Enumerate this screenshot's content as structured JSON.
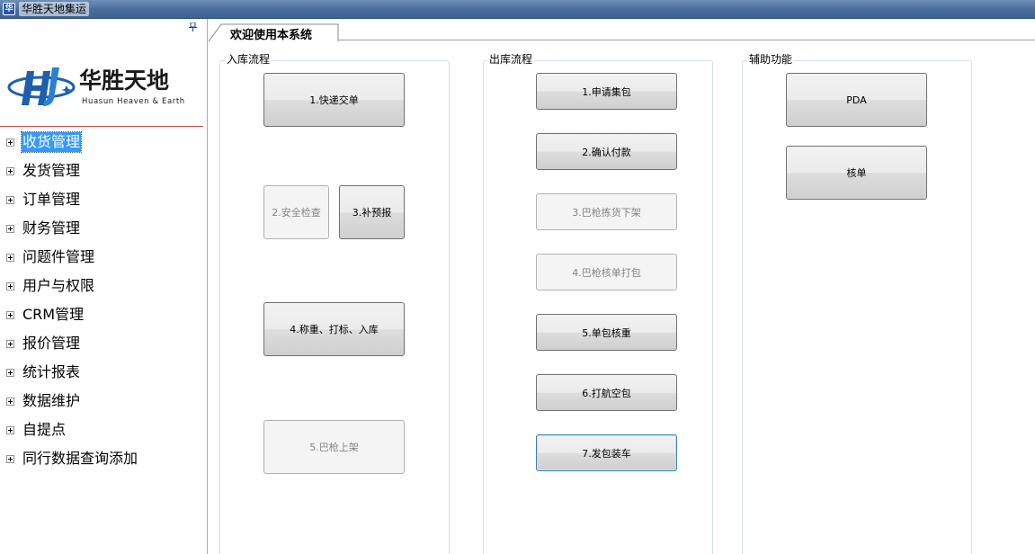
{
  "window": {
    "title": "华胜天地集运"
  },
  "logo": {
    "text_cn": "华胜天地",
    "text_en": "Huasun Heaven & Earth"
  },
  "sidebar": {
    "items": [
      {
        "label": "收货管理"
      },
      {
        "label": "发货管理"
      },
      {
        "label": "订单管理"
      },
      {
        "label": "财务管理"
      },
      {
        "label": "问题件管理"
      },
      {
        "label": "用户与权限"
      },
      {
        "label": "CRM管理"
      },
      {
        "label": "报价管理"
      },
      {
        "label": "统计报表"
      },
      {
        "label": "数据维护"
      },
      {
        "label": "自提点"
      },
      {
        "label": "同行数据查询添加"
      }
    ],
    "selected_index": 0
  },
  "tabs": [
    {
      "label": "欢迎使用本系统"
    }
  ],
  "groups": {
    "inbound": {
      "title": "入库流程",
      "buttons": [
        {
          "label": "1.快递交单",
          "enabled": true
        },
        {
          "label": "2.安全检查",
          "enabled": false
        },
        {
          "label": "3.补预报",
          "enabled": true
        },
        {
          "label": "4.称重、打标、入库",
          "enabled": true
        },
        {
          "label": "5.巴枪上架",
          "enabled": false
        }
      ]
    },
    "outbound": {
      "title": "出库流程",
      "buttons": [
        {
          "label": "1.申请集包",
          "enabled": true
        },
        {
          "label": "2.确认付款",
          "enabled": true
        },
        {
          "label": "3.巴枪拣货下架",
          "enabled": false
        },
        {
          "label": "4.巴枪核单打包",
          "enabled": false
        },
        {
          "label": "5.单包核重",
          "enabled": true
        },
        {
          "label": "6.打航空包",
          "enabled": true
        },
        {
          "label": "7.发包装车",
          "enabled": true
        }
      ]
    },
    "auxiliary": {
      "title": "辅助功能",
      "buttons": [
        {
          "label": "PDA",
          "enabled": true
        },
        {
          "label": "核单",
          "enabled": true
        }
      ]
    }
  }
}
